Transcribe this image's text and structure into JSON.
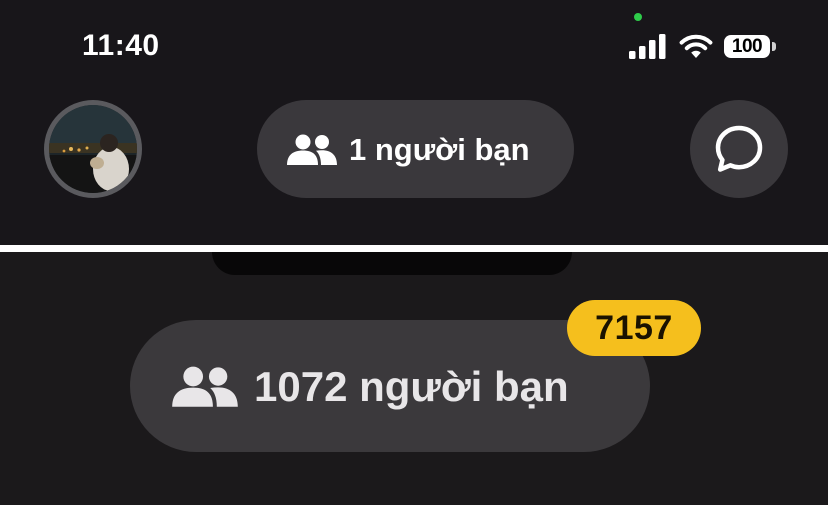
{
  "status_bar": {
    "time": "11:40",
    "battery": "100"
  },
  "header": {
    "friends_label": "1 người bạn"
  },
  "compare": {
    "friends_label": "1072 người bạn",
    "badge_count": "7157"
  },
  "icons": {
    "signal": "signal-bars-icon",
    "wifi": "wifi-icon",
    "battery": "battery-icon",
    "friends": "people-icon",
    "chat": "chat-bubble-icon"
  },
  "colors": {
    "background": "#18161a",
    "pill": "#3a383c",
    "badge": "#f5bf1d",
    "camera_indicator": "#2ecc4a"
  }
}
